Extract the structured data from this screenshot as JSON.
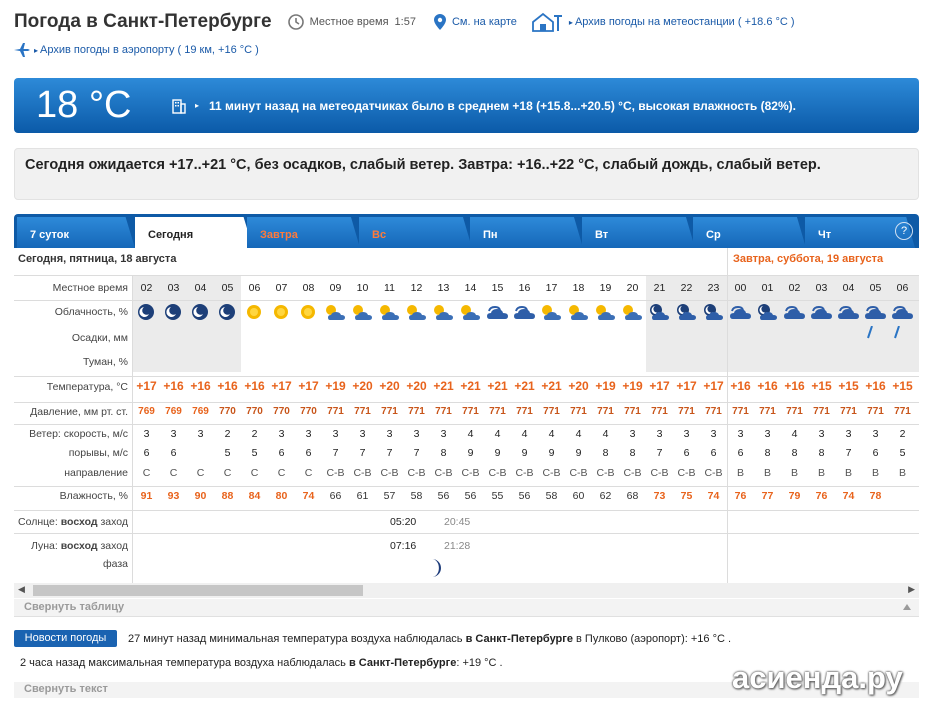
{
  "header": {
    "title": "Погода в Санкт-Петербурге",
    "local_time_label": "Местное время",
    "local_time": "1:57",
    "map_link": "См. на карте",
    "station_archive": "Архив погоды на метеостанции ( +18.6 °C )",
    "airport_archive": "Архив погоды в аэропорту ( 19 км, +16 °C )"
  },
  "now": {
    "temp": "18 °C",
    "text": "11 минут назад на метеодатчиках было в среднем +18 (+15.8...+20.5) °C, высокая влажность (82%)."
  },
  "forecast": {
    "text": "Сегодня ожидается +17..+21 °C, без осадков, слабый ветер. Завтра: +16..+22 °C, слабый дождь, слабый ветер."
  },
  "tabs": [
    "7 суток",
    "Сегодня",
    "Завтра",
    "Вс",
    "Пн",
    "Вт",
    "Ср",
    "Чт"
  ],
  "help": "?",
  "day_headers": {
    "today": "Сегодня, пятница, 18 августа",
    "tomorrow": "Завтра, суббота, 19 августа"
  },
  "labels": {
    "time": "Местное время",
    "clouds": "Облачность, %",
    "precip": "Осадки, мм",
    "fog": "Туман, %",
    "temp": "Температура, °C",
    "pressure": "Давление, мм рт. ст.",
    "wind": "Ветер: скорость, м/с",
    "gusts": "порывы, м/с",
    "dir": "направление",
    "humidity": "Влажность, %",
    "sun_a": "Солнце:",
    "sun_b": "восход",
    "sun_c": "заход",
    "moon_a": "Луна:",
    "moon_b": "восход",
    "moon_c": "заход",
    "moon_phase": "фаза"
  },
  "hours": [
    "02",
    "03",
    "04",
    "05",
    "06",
    "07",
    "08",
    "09",
    "10",
    "11",
    "12",
    "13",
    "14",
    "15",
    "16",
    "17",
    "18",
    "19",
    "20",
    "21",
    "22",
    "23",
    "00",
    "01",
    "02",
    "03",
    "04",
    "05",
    "06"
  ],
  "cloud_icons": [
    "moon-clear",
    "moon-clear",
    "moon-clear",
    "moon-clear",
    "sun",
    "sun",
    "sun",
    "sun-cloud",
    "sun-cloud",
    "sun-cloud",
    "sun-cloud",
    "sun-cloud",
    "sun-cloud",
    "cloud",
    "cloud",
    "sun-cloud",
    "sun-cloud",
    "sun-cloud",
    "sun-cloud",
    "moon-cloud",
    "moon-cloud",
    "moon-cloud",
    "cloud",
    "moon-cloud",
    "cloud",
    "cloud",
    "cloud",
    "cloud",
    "cloud-rain"
  ],
  "rain_drops": [
    27,
    28
  ],
  "temps": [
    "+17",
    "+16",
    "+16",
    "+16",
    "+16",
    "+17",
    "+17",
    "+19",
    "+20",
    "+20",
    "+20",
    "+21",
    "+21",
    "+21",
    "+21",
    "+21",
    "+20",
    "+19",
    "+19",
    "+17",
    "+17",
    "+17",
    "+16",
    "+16",
    "+16",
    "+15",
    "+15",
    "+16",
    "+15"
  ],
  "pressure": [
    "769",
    "769",
    "769",
    "770",
    "770",
    "770",
    "770",
    "771",
    "771",
    "771",
    "771",
    "771",
    "771",
    "771",
    "771",
    "771",
    "771",
    "771",
    "771",
    "771",
    "771",
    "771",
    "771",
    "771",
    "771",
    "771",
    "771",
    "771",
    "771"
  ],
  "wind": [
    "3",
    "3",
    "3",
    "2",
    "2",
    "3",
    "3",
    "3",
    "3",
    "3",
    "3",
    "3",
    "4",
    "4",
    "4",
    "4",
    "4",
    "4",
    "3",
    "3",
    "3",
    "3",
    "3",
    "3",
    "4",
    "3",
    "3",
    "3",
    "2"
  ],
  "gusts": [
    "6",
    "6",
    "",
    "5",
    "5",
    "6",
    "6",
    "7",
    "7",
    "7",
    "7",
    "8",
    "9",
    "9",
    "9",
    "9",
    "9",
    "8",
    "8",
    "7",
    "6",
    "6",
    "6",
    "8",
    "8",
    "8",
    "7",
    "6",
    "5"
  ],
  "wind_dir": [
    "С",
    "С",
    "С",
    "С",
    "С",
    "С",
    "С",
    "С-В",
    "С-В",
    "С-В",
    "С-В",
    "С-В",
    "С-В",
    "С-В",
    "С-В",
    "С-В",
    "С-В",
    "С-В",
    "С-В",
    "С-В",
    "С-В",
    "С-В",
    "В",
    "В",
    "В",
    "В",
    "В",
    "В",
    "В"
  ],
  "humidity": [
    "91",
    "93",
    "90",
    "88",
    "84",
    "80",
    "74",
    "66",
    "61",
    "57",
    "58",
    "56",
    "56",
    "55",
    "56",
    "58",
    "60",
    "62",
    "68",
    "73",
    "75",
    "74",
    "76",
    "77",
    "79",
    "76",
    "74",
    "78"
  ],
  "sun": {
    "rise": "05:20",
    "set": "20:45"
  },
  "moon": {
    "rise": "07:16",
    "set": "21:28"
  },
  "collapse_table": "Свернуть таблицу",
  "news": {
    "badge": "Новости погоды",
    "line1_a": "27 минут назад минимальная температура воздуха наблюдалась ",
    "line1_b": "в Санкт-Петербурге",
    "line1_c": " в Пулково (аэропорт): +16 °C .",
    "line2_a": "2 часа назад максимальная температура воздуха наблюдалась ",
    "line2_b": "в Санкт-Петербурге",
    "line2_c": ": +19 °C ."
  },
  "collapse_text": "Свернуть текст",
  "watermark": "асиенда.ру",
  "colors": {
    "accent": "#1a63b1",
    "temp": "#e8631c",
    "weekend": "#ff7a3a"
  }
}
